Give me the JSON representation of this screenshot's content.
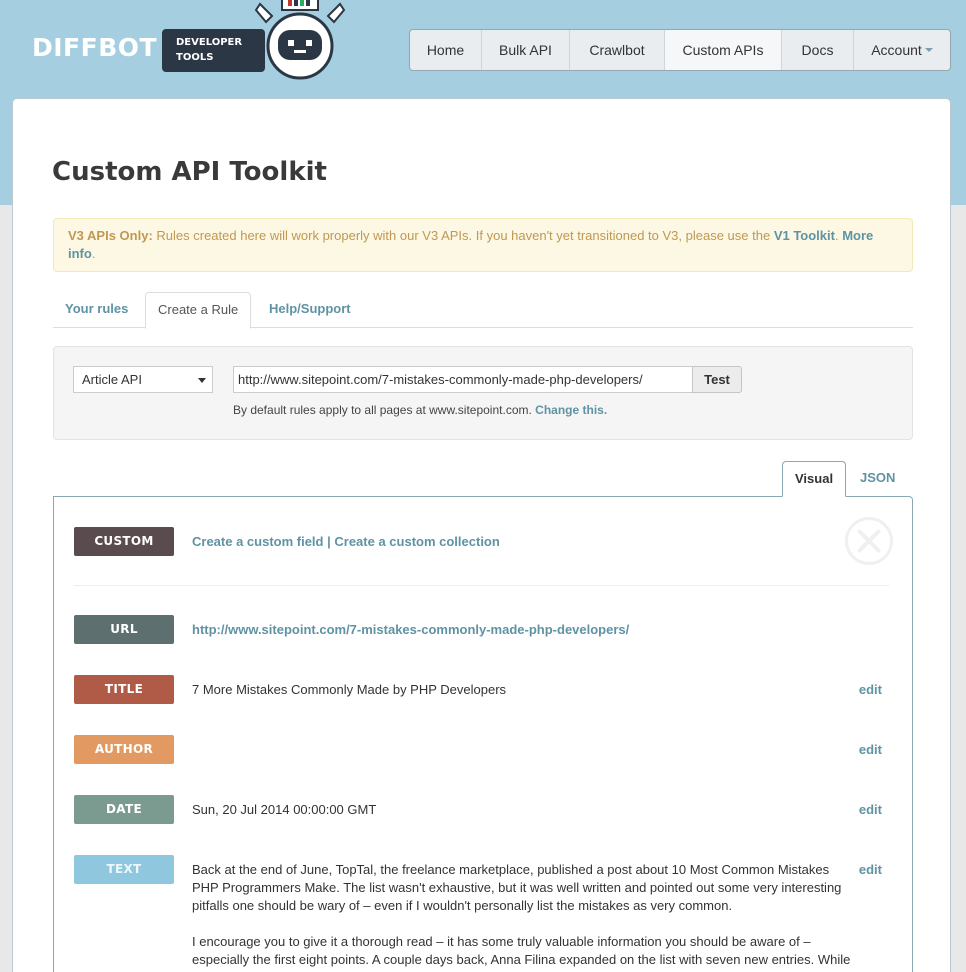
{
  "header": {
    "logo": "DIFFBOT",
    "devtools_line1": "DEVELOPER",
    "devtools_line2": "TOOLS"
  },
  "nav": {
    "items": [
      {
        "label": "Home"
      },
      {
        "label": "Bulk API"
      },
      {
        "label": "Crawlbot"
      },
      {
        "label": "Custom APIs"
      },
      {
        "label": "Docs"
      },
      {
        "label": "Account"
      }
    ]
  },
  "page": {
    "title": "Custom API Toolkit"
  },
  "notice": {
    "bold": "V3 APIs Only:",
    "text": " Rules created here will work properly with our V3 APIs. If you haven't yet transitioned to V3, please use the ",
    "link1": "V1 Toolkit",
    "sep": ". ",
    "link2": "More info",
    "end": "."
  },
  "tabs": {
    "your_rules": "Your rules",
    "create_rule": "Create a Rule",
    "help": "Help/Support"
  },
  "form": {
    "api_select": "Article API",
    "url_value": "http://www.sitepoint.com/7-mistakes-commonly-made-php-developers/",
    "test_label": "Test",
    "scope_text": "By default rules apply to all pages at www.sitepoint.com.",
    "scope_link": "Change this."
  },
  "view_tabs": {
    "visual": "Visual",
    "json": "JSON"
  },
  "fields": {
    "custom_badge": "CUSTOM",
    "custom_field_link": "Create a custom field",
    "custom_sep": " | ",
    "custom_collection_link": "Create a custom collection",
    "url_badge": "URL",
    "url_value": "http://www.sitepoint.com/7-mistakes-commonly-made-php-developers/",
    "title_badge": "TITLE",
    "title_value": "7 More Mistakes Commonly Made by PHP Developers",
    "author_badge": "AUTHOR",
    "date_badge": "DATE",
    "date_value": "Sun, 20 Jul 2014 00:00:00 GMT",
    "text_badge": "TEXT",
    "text_p1": "Back at the end of June, TopTal, the freelance marketplace, published a post about 10 Most Common Mistakes PHP Programmers Make. The list wasn't exhaustive, but it was well written and pointed out some very interesting pitfalls one should be wary of – even if I wouldn't personally list the mistakes as very common.",
    "text_p2": "I encourage you to give it a thorough read – it has some truly valuable information you should be aware of – especially the first eight points. A couple days back, Anna Filina expanded on the list with seven new entries. While less specific and common, her points still carry weight and should be considered when developing.",
    "edit_label": "edit"
  }
}
